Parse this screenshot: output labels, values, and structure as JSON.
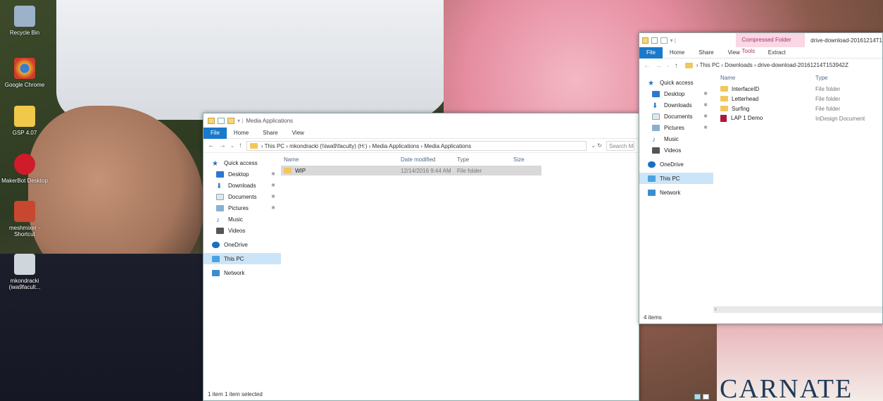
{
  "desktop": {
    "icons": [
      {
        "label": "Recycle Bin",
        "color": "#9bb2c9"
      },
      {
        "label": "Google Chrome",
        "color": "#e8b02a"
      },
      {
        "label": "GSP 4.07",
        "color": "#f0c84a"
      },
      {
        "label": "MakerBot Desktop",
        "color": "#d01b2a"
      },
      {
        "label": "meshmixer - Shortcut",
        "color": "#c7472f"
      },
      {
        "label": "mkondracki (iwa9facult...",
        "color": "#cfd6dc"
      }
    ]
  },
  "book_text": "CARNATE",
  "win1": {
    "title": "Media Applications",
    "ribbon": {
      "file": "File",
      "home": "Home",
      "share": "Share",
      "view": "View"
    },
    "address": "This PC  ›  mkondracki (\\\\iwa9\\faculty) (H:)  ›  Media Applications  ›  Media Applications",
    "search": "Search Media Applications",
    "nav": [
      {
        "label": "Quick access",
        "icon": "star"
      },
      {
        "label": "Desktop",
        "icon": "desktop",
        "pin": "📌"
      },
      {
        "label": "Downloads",
        "icon": "download",
        "pin": "📌"
      },
      {
        "label": "Documents",
        "icon": "documents",
        "pin": "📌"
      },
      {
        "label": "Pictures",
        "icon": "pictures",
        "pin": "📌"
      },
      {
        "label": "Music",
        "icon": "music"
      },
      {
        "label": "Videos",
        "icon": "videos"
      },
      {
        "label": "OneDrive",
        "icon": "cloud"
      },
      {
        "label": "This PC",
        "icon": "pc"
      },
      {
        "label": "Network",
        "icon": "network"
      }
    ],
    "columns": {
      "name": "Name",
      "date": "Date modified",
      "type": "Type",
      "size": "Size"
    },
    "rows": [
      {
        "name": "WIP",
        "date": "12/14/2016 9:44 AM",
        "type": "File folder",
        "size": ""
      }
    ],
    "status": "1 item    1 item selected"
  },
  "win2": {
    "tools_tab": "Compressed Folder Tools",
    "title": "drive-download-20161214T1",
    "ribbon": {
      "file": "File",
      "home": "Home",
      "share": "Share",
      "view": "View",
      "extract": "Extract"
    },
    "address": "This PC  ›  Downloads  ›  drive-download-20161214T153942Z",
    "nav": [
      {
        "label": "Quick access"
      },
      {
        "label": "Desktop",
        "pin": "📌"
      },
      {
        "label": "Downloads",
        "pin": "📌"
      },
      {
        "label": "Documents",
        "pin": "📌"
      },
      {
        "label": "Pictures",
        "pin": "📌"
      },
      {
        "label": "Music"
      },
      {
        "label": "Videos"
      },
      {
        "label": "OneDrive"
      },
      {
        "label": "This PC"
      },
      {
        "label": "Network"
      }
    ],
    "columns": {
      "name": "Name",
      "type": "Type"
    },
    "rows": [
      {
        "name": "InterfaceID",
        "type": "File folder",
        "kind": "folder"
      },
      {
        "name": "Letterhead",
        "type": "File folder",
        "kind": "folder"
      },
      {
        "name": "Surfing",
        "type": "File folder",
        "kind": "folder"
      },
      {
        "name": "LAP 1 Demo",
        "type": "InDesign Document",
        "kind": "indd"
      }
    ],
    "status": "4 items"
  }
}
